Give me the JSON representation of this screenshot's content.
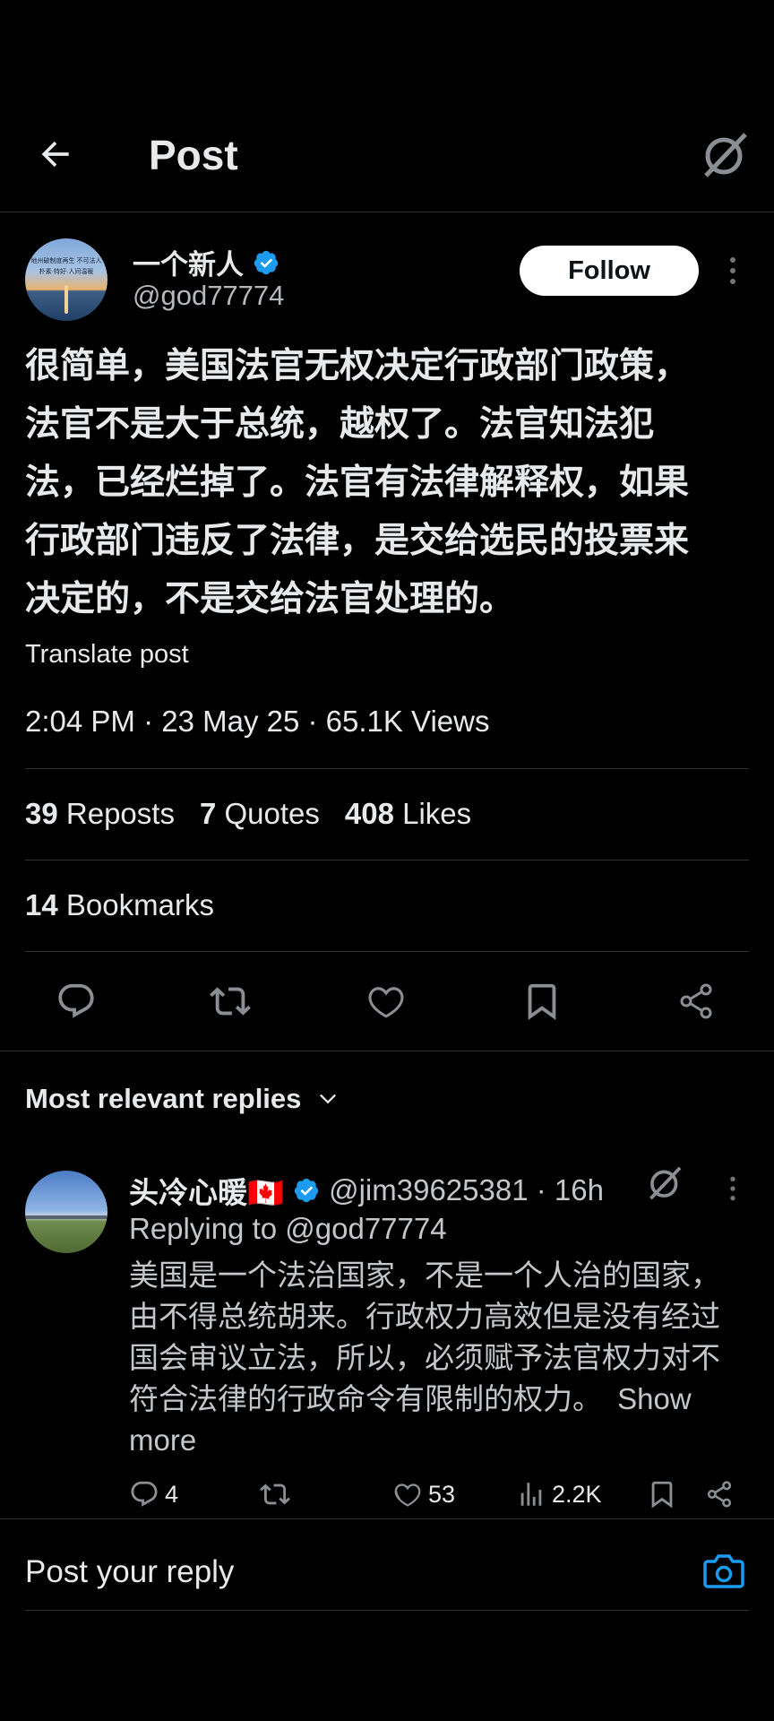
{
  "header": {
    "title": "Post",
    "back_icon": "arrow-left-icon",
    "grok_icon": "grok-icon"
  },
  "post": {
    "author_name": "一个新人",
    "verified": true,
    "handle": "@god77774",
    "follow_label": "Follow",
    "avatar_text_line1": "地州破制度再生 不可法人",
    "avatar_text_line2": "朴素·特好·人间温暖",
    "text_lines": [
      "很简单，美国法官无权决定行政部门政策，",
      "法官不是大于总统，越权了。法官知法犯",
      "法，已经烂掉了。法官有法律解释权，如果",
      "行政部门违反了法律，是交给选民的投票来",
      "决定的，不是交给法官处理的。"
    ],
    "translate_label": "Translate post",
    "meta": "2:04 PM · 23 May 25 · 65.1K Views",
    "stats": {
      "reposts_count": "39",
      "reposts_label": "Reposts",
      "quotes_count": "7",
      "quotes_label": "Quotes",
      "likes_count": "408",
      "likes_label": "Likes",
      "bookmarks_count": "14",
      "bookmarks_label": "Bookmarks"
    }
  },
  "replies_section": {
    "filter_label": "Most relevant replies"
  },
  "reply": {
    "author_name": "头冷心暖🇨🇦",
    "verified": true,
    "handle_time": "@jim39625381 · 16h",
    "replying_to": "Replying to @god77774",
    "text_lines": [
      "美国是一个法治国家，不是一个人治的国家，",
      "由不得总统胡来。行政权力高效但是没有经过",
      "国会审议立法，所以，必须赋予法官权力对不",
      "符合法律的行政命令有限制的权力。"
    ],
    "show_more_a": "Show",
    "show_more_b": "more",
    "comments": "4",
    "likes": "53",
    "views": "2.2K"
  },
  "composer": {
    "placeholder": "Post your reply",
    "camera_icon": "camera-icon"
  },
  "colors": {
    "background": "#000000",
    "accent": "#1d9bf0",
    "divider": "#2f3336",
    "muted": "#71767b"
  }
}
